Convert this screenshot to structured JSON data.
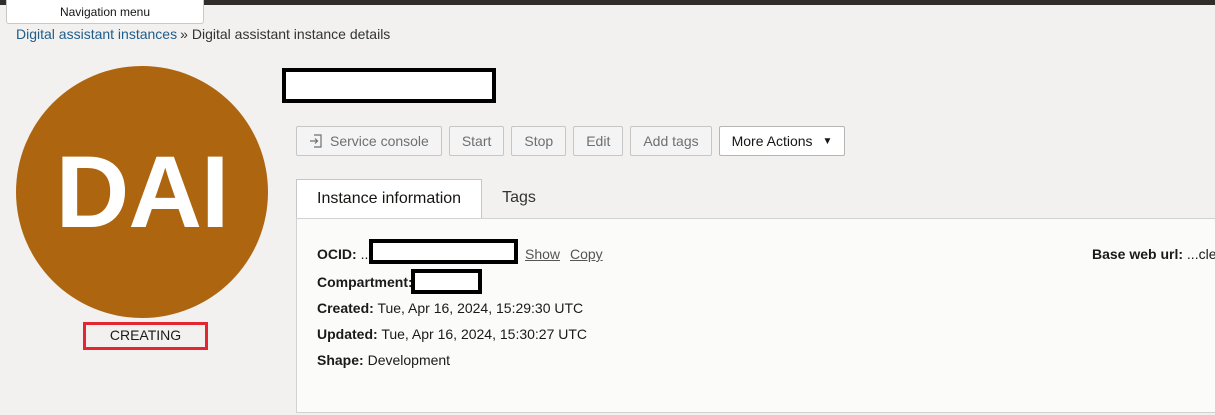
{
  "nav": {
    "menu_label": "Navigation menu"
  },
  "breadcrumb": {
    "parent": "Digital assistant instances",
    "separator": "»",
    "current": "Digital assistant instance details"
  },
  "avatar": {
    "initials": "DAI",
    "status": "CREATING",
    "color": "#ae650f"
  },
  "actions": {
    "service_console": "Service console",
    "start": "Start",
    "stop": "Stop",
    "edit": "Edit",
    "add_tags": "Add tags",
    "more_actions": "More Actions"
  },
  "tabs": {
    "instance_information": "Instance information",
    "tags": "Tags"
  },
  "info": {
    "ocid_label": "OCID:",
    "ocid_prefix": "..",
    "show": "Show",
    "copy": "Copy",
    "compartment_label": "Compartment:",
    "created_label": "Created:",
    "created_value": "Tue, Apr 16, 2024, 15:29:30 UTC",
    "updated_label": "Updated:",
    "updated_value": "Tue, Apr 16, 2024, 15:30:27 UTC",
    "shape_label": "Shape:",
    "shape_value": "Development",
    "base_web_url_label": "Base web url:",
    "base_web_url_value": "...cle"
  },
  "icons": {
    "service_console": "external-link-icon",
    "more_actions": "caret-down-icon"
  },
  "colors": {
    "link": "#1f5d8c",
    "status_outline": "#e3262f",
    "avatar": "#ae650f"
  }
}
